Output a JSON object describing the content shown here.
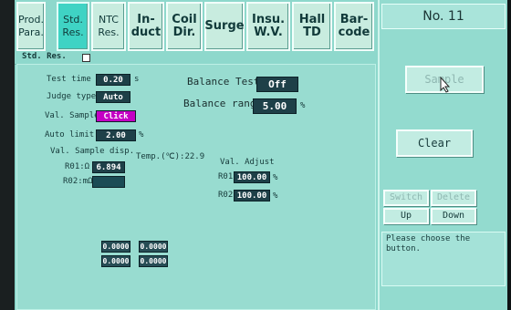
{
  "tabs": [
    {
      "line1": "Prod.",
      "line2": "Para.",
      "active": false
    },
    {
      "line1": "Std.",
      "line2": "Res.",
      "active": true
    },
    {
      "line1": "NTC",
      "line2": "Res.",
      "active": false
    },
    {
      "line1": "In-",
      "line2": "duct",
      "active": false
    },
    {
      "line1": "Coil",
      "line2": "Dir.",
      "active": false
    },
    {
      "line1": "Surge",
      "line2": "",
      "active": false
    },
    {
      "line1": "Insu.",
      "line2": "W.V.",
      "active": false
    },
    {
      "line1": "Hall",
      "line2": "TD",
      "active": false
    },
    {
      "line1": "Bar-",
      "line2": "code",
      "active": false
    }
  ],
  "panel": {
    "title": "Std. Res.",
    "test_time_label": "Test time",
    "test_time_value": "0.20",
    "test_time_unit": "s",
    "judge_type_label": "Judge type",
    "judge_type_value": "Auto",
    "val_sample_label": "Val. Sample",
    "val_sample_value": "Click",
    "auto_limit_label": "Auto limit",
    "auto_limit_value": "2.00",
    "auto_limit_unit": "%",
    "balance_test_label": "Balance Test",
    "balance_test_value": "Off",
    "balance_range_label": "Balance range",
    "balance_range_value": "5.00",
    "balance_range_unit": "%",
    "val_sample_disp_label": "Val. Sample disp.",
    "temp_label": "Temp.(℃):22.9",
    "r01_label": "R01:Ω",
    "r01_value": "6.894",
    "r02_label": "R02:mΩ",
    "r02_value": "",
    "val_adjust_label": "Val. Adjust",
    "adj_r01_label": "R01",
    "adj_r01_value": "100.00",
    "adj_r01_unit": "%",
    "adj_r02_label": "R02",
    "adj_r02_value": "100.00",
    "adj_r02_unit": "%",
    "grid_values": [
      "0.0000",
      "0.0000",
      "0.0000",
      "0.0000"
    ]
  },
  "right": {
    "title": "No. 11",
    "sample_label": "Sample",
    "clear_label": "Clear",
    "switch_label": "Switch",
    "delete_label": "Delete",
    "up_label": "Up",
    "down_label": "Down",
    "message": "Please choose the button."
  }
}
